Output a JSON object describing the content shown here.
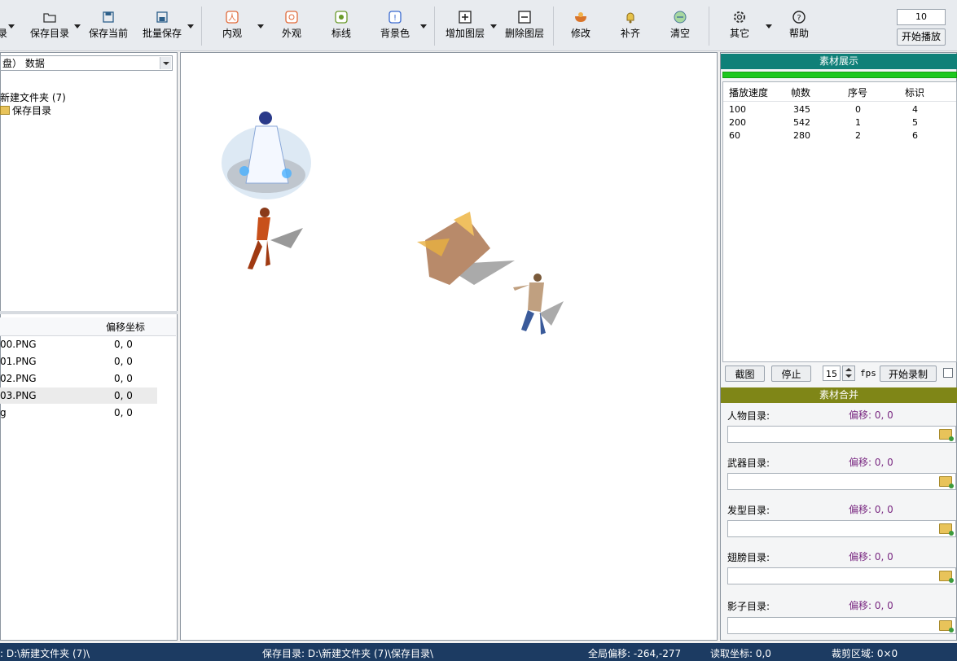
{
  "toolbar": {
    "buttons": [
      {
        "label": "录"
      },
      {
        "label": "保存目录"
      },
      {
        "label": "保存当前"
      },
      {
        "label": "批量保存"
      },
      {
        "label": "内观"
      },
      {
        "label": "外观"
      },
      {
        "label": "标线"
      },
      {
        "label": "背景色"
      },
      {
        "label": "增加图层"
      },
      {
        "label": "删除图层"
      },
      {
        "label": "修改"
      },
      {
        "label": "补齐"
      },
      {
        "label": "清空"
      },
      {
        "label": "其它"
      },
      {
        "label": "帮助"
      }
    ],
    "number_value": "10",
    "play_label": "开始播放"
  },
  "left": {
    "drive": "盘） 数据",
    "tree": [
      {
        "label": "新建文件夹 (7)"
      },
      {
        "label": "保存目录"
      }
    ],
    "file_columns": [
      "偏移坐标"
    ],
    "files": [
      {
        "name": "00.PNG",
        "offset": "0, 0"
      },
      {
        "name": "01.PNG",
        "offset": "0, 0"
      },
      {
        "name": "02.PNG",
        "offset": "0, 0"
      },
      {
        "name": "03.PNG",
        "offset": "0, 0"
      },
      {
        "name": "g",
        "offset": "0, 0"
      }
    ]
  },
  "right": {
    "display_title": "素材展示",
    "list_headers": [
      "播放速度",
      "帧数",
      "序号",
      "标识"
    ],
    "list_rows": [
      [
        "100",
        "345",
        "0",
        "4"
      ],
      [
        "200",
        "542",
        "1",
        "5"
      ],
      [
        "60",
        "280",
        "2",
        "6"
      ]
    ],
    "screenshot_label": "截图",
    "stop_label": "停止",
    "fps_value": "15",
    "fps_unit": "fps",
    "record_label": "开始录制",
    "merge_title": "素材合并",
    "dirs": [
      {
        "label": "人物目录:",
        "offset": "偏移: 0, 0"
      },
      {
        "label": "武器目录:",
        "offset": "偏移: 0, 0"
      },
      {
        "label": "发型目录:",
        "offset": "偏移: 0, 0"
      },
      {
        "label": "翅膀目录:",
        "offset": "偏移: 0, 0"
      },
      {
        "label": "影子目录:",
        "offset": "偏移: 0, 0"
      }
    ]
  },
  "status": {
    "path": ": D:\\新建文件夹 (7)\\",
    "save_dir": "保存目录: D:\\新建文件夹 (7)\\保存目录\\",
    "global_offset": "全局偏移: -264,-277",
    "read_coord": "读取坐标: 0,0",
    "crop_area": "裁剪区域: 0×0"
  },
  "colors": {
    "display_title_bg": "#0f8078",
    "merge_title_bg": "#7f8617",
    "statusbar_bg": "#1c3b62",
    "progress": "#1ec81e"
  }
}
